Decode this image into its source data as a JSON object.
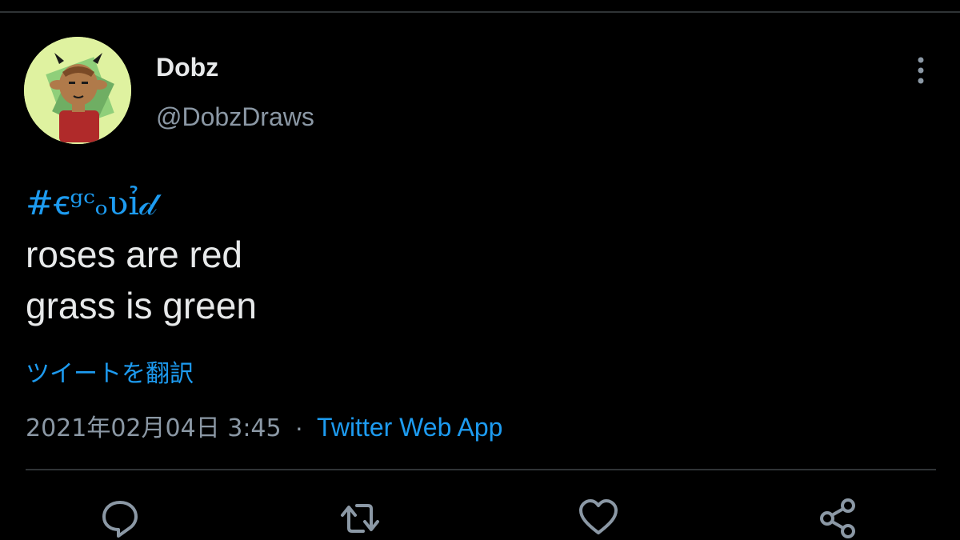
{
  "tweet": {
    "author": {
      "display_name": "Dobz",
      "handle": "@DobzDraws",
      "avatar_icon": "avatar-illustration"
    },
    "hashtag": "#ꞓᵍᶜₒʋỉ𝒹",
    "lines": [
      "roses are red",
      "grass is green"
    ],
    "translate_label": "ツイートを翻訳",
    "timestamp": "2021年02月04日 3:45",
    "separator": "·",
    "source": "Twitter Web App"
  },
  "actions": {
    "reply_icon": "reply-icon",
    "retweet_icon": "retweet-icon",
    "like_icon": "heart-icon",
    "share_icon": "share-icon",
    "more_icon": "more-vertical-icon"
  },
  "colors": {
    "background": "#000000",
    "text_primary": "#e7e9ea",
    "text_secondary": "#8b98a5",
    "accent": "#1d9bf0",
    "divider": "#2f3336",
    "avatar_bg": "#dff2a0"
  }
}
